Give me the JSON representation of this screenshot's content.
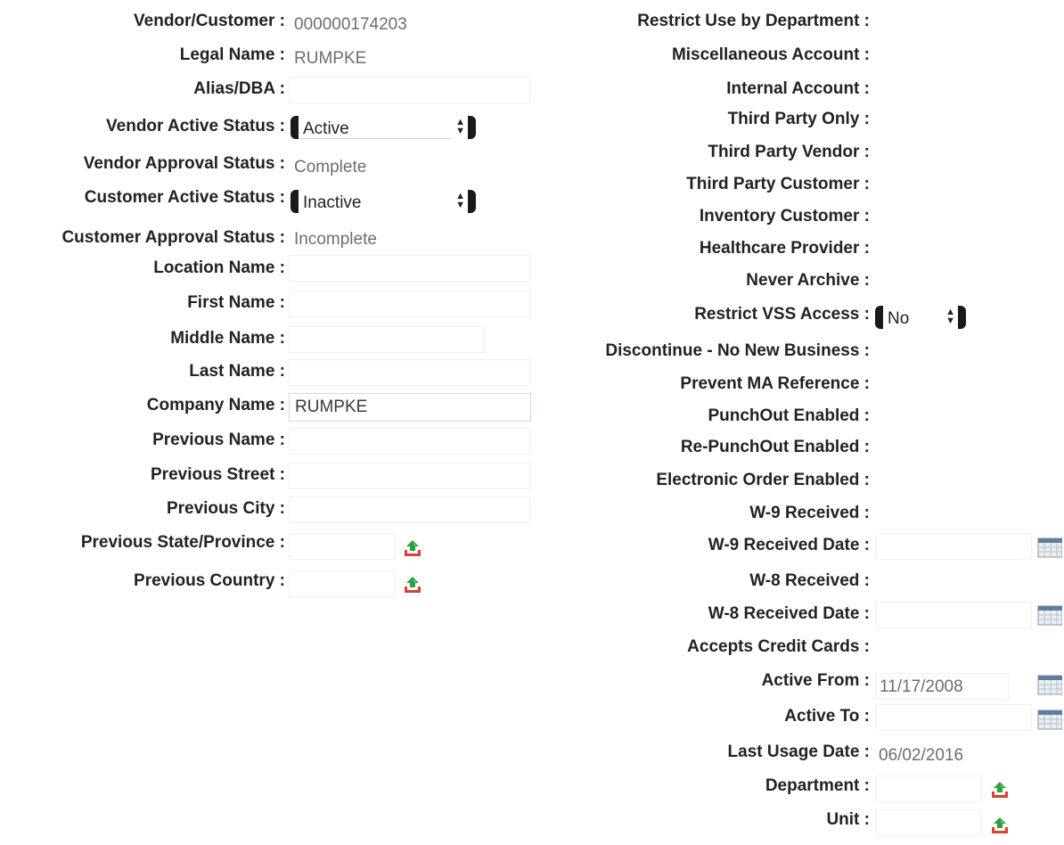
{
  "left": {
    "vendor_customer": {
      "label": "Vendor/Customer :",
      "value": "000000174203"
    },
    "legal_name": {
      "label": "Legal Name :",
      "value": "RUMPKE"
    },
    "alias_dba": {
      "label": "Alias/DBA :",
      "value": ""
    },
    "vendor_active_status": {
      "label": "Vendor Active Status :",
      "selected": "Active"
    },
    "vendor_approval_status": {
      "label": "Vendor Approval Status :",
      "value": "Complete"
    },
    "customer_active_status": {
      "label": "Customer Active Status :",
      "selected": "Inactive"
    },
    "customer_approval_status": {
      "label": "Customer Approval Status :",
      "value": "Incomplete"
    },
    "location_name": {
      "label": "Location Name :",
      "value": ""
    },
    "first_name": {
      "label": "First Name :",
      "value": ""
    },
    "middle_name": {
      "label": "Middle Name :",
      "value": ""
    },
    "last_name": {
      "label": "Last Name :",
      "value": ""
    },
    "company_name": {
      "label": "Company Name :",
      "value": "RUMPKE"
    },
    "previous_name": {
      "label": "Previous Name :",
      "value": ""
    },
    "previous_street": {
      "label": "Previous Street :",
      "value": ""
    },
    "previous_city": {
      "label": "Previous City :",
      "value": ""
    },
    "previous_state": {
      "label": "Previous State/Province :",
      "value": ""
    },
    "previous_country": {
      "label": "Previous Country :",
      "value": ""
    }
  },
  "right": {
    "restrict_use_by_department": {
      "label": "Restrict Use by Department :"
    },
    "miscellaneous_account": {
      "label": "Miscellaneous Account :"
    },
    "internal_account": {
      "label": "Internal Account :"
    },
    "third_party_only": {
      "label": "Third Party Only :"
    },
    "third_party_vendor": {
      "label": "Third Party Vendor :"
    },
    "third_party_customer": {
      "label": "Third Party Customer :"
    },
    "inventory_customer": {
      "label": "Inventory Customer :"
    },
    "healthcare_provider": {
      "label": "Healthcare Provider :"
    },
    "never_archive": {
      "label": "Never Archive :"
    },
    "restrict_vss_access": {
      "label": "Restrict VSS Access :",
      "selected": "No"
    },
    "discontinue_no_new_business": {
      "label": "Discontinue - No New Business :"
    },
    "prevent_ma_reference": {
      "label": "Prevent MA Reference :"
    },
    "punchout_enabled": {
      "label": "PunchOut Enabled :"
    },
    "re_punchout_enabled": {
      "label": "Re-PunchOut Enabled :"
    },
    "electronic_order_enabled": {
      "label": "Electronic Order Enabled :"
    },
    "w9_received": {
      "label": "W-9 Received :"
    },
    "w9_received_date": {
      "label": "W-9 Received Date :",
      "value": ""
    },
    "w8_received": {
      "label": "W-8 Received :"
    },
    "w8_received_date": {
      "label": "W-8 Received Date :",
      "value": ""
    },
    "accepts_credit_cards": {
      "label": "Accepts Credit Cards :"
    },
    "active_from": {
      "label": "Active From :",
      "value": "11/17/2008"
    },
    "active_to": {
      "label": "Active To :",
      "value": ""
    },
    "last_usage_date": {
      "label": "Last Usage Date :",
      "value": "06/02/2016"
    },
    "department": {
      "label": "Department :",
      "value": ""
    },
    "unit": {
      "label": "Unit :",
      "value": ""
    }
  },
  "icons": {
    "lookup": "lookup-upload-icon",
    "calendar": "calendar-icon",
    "select_arrows": "up-down-arrows-icon"
  },
  "colors": {
    "label_text": "#222222",
    "value_text": "#6d6d6d",
    "field_border": "#c9dbe6",
    "lookup_green": "#2e9e3e",
    "lookup_red": "#d9412f"
  }
}
